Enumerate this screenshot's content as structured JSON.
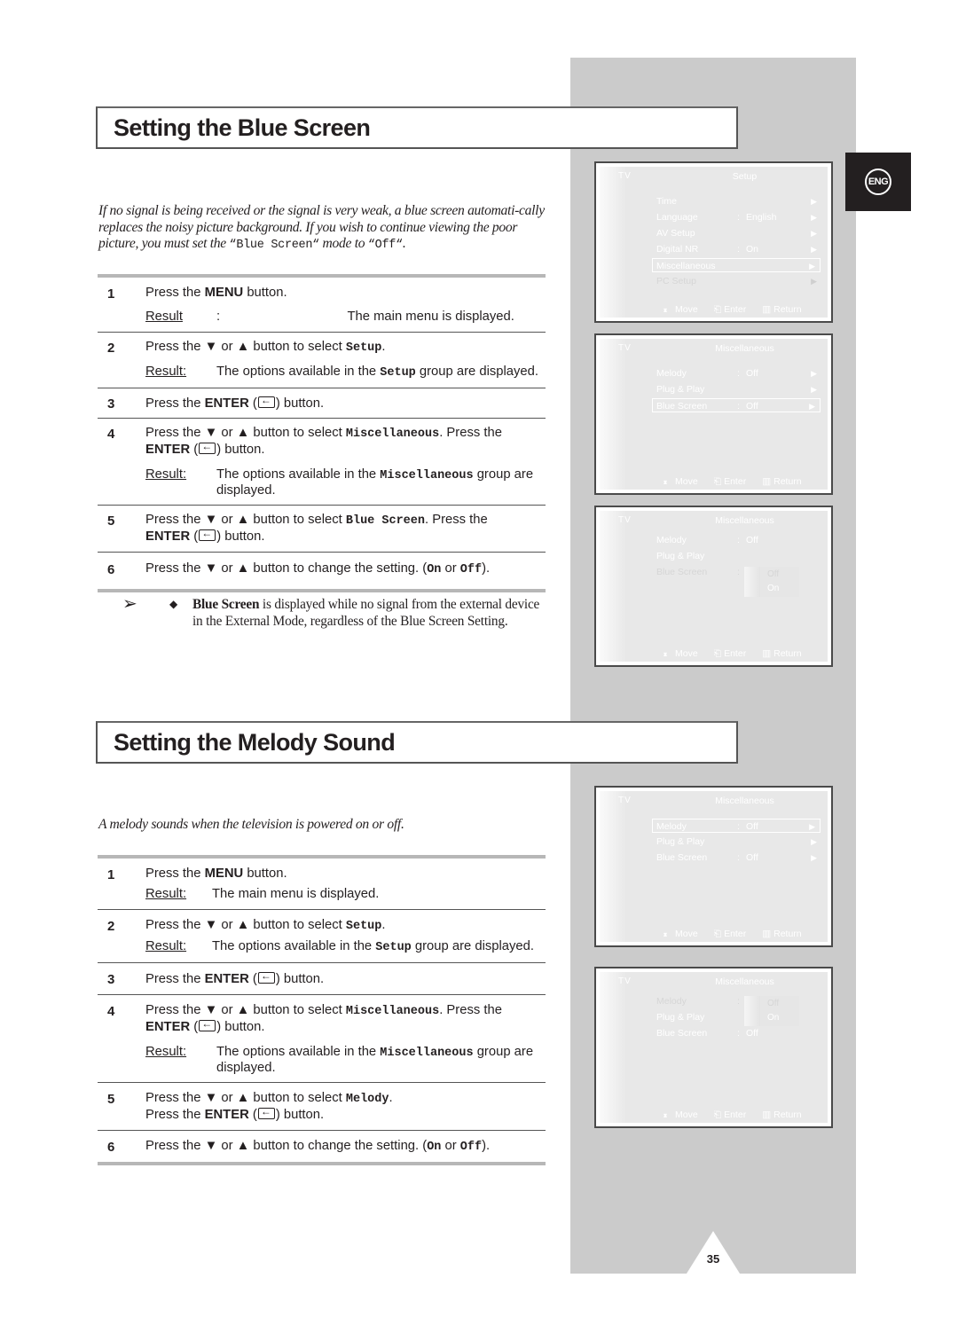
{
  "page": {
    "language_badge": "ENG",
    "page_number": "35"
  },
  "blue_screen": {
    "title": "Setting the Blue Screen",
    "intro": {
      "part1": "If no signal is being received or the signal is very weak, a blue screen automati-cally replaces the noisy picture background. If you wish to continue viewing the poor picture, you must set the ",
      "code1": "“Blue Screen“",
      "part2": " mode to ",
      "code2": "“Off“",
      "part3": "."
    },
    "steps": [
      {
        "num": "1",
        "pre": "Press the ",
        "key": "MENU",
        "post": " button.",
        "result_label": "Result",
        "result": "The main menu is displayed."
      },
      {
        "num": "2",
        "pre": "Press the ▼ or ▲ button to select ",
        "code": "Setup",
        "post": ".",
        "result_label": "Result",
        "result_pre": "The options available in the ",
        "result_code": "Setup",
        "result_post": " group are displayed."
      },
      {
        "num": "3",
        "pre": "Press the ",
        "key": "ENTER",
        "open": " (",
        "close": ") button."
      },
      {
        "num": "4",
        "pre": "Press the ▼ or ▲ button to select ",
        "code": "Miscellaneous",
        "mid": ". Press the",
        "key": "ENTER",
        "open": " (",
        "close": ") button.",
        "result_label": "Result",
        "result_pre": "The options available in the ",
        "result_code": "Miscellaneous",
        "result_post": " group are displayed."
      },
      {
        "num": "5",
        "pre": "Press the ▼ or ▲ button to select ",
        "code": "Blue Screen",
        "mid": ". Press the",
        "key": "ENTER",
        "open": " (",
        "close": ") button."
      },
      {
        "num": "6",
        "pre": "Press the ▼ or ▲ button to change the setting. (",
        "code_on": "On",
        "or": " or ",
        "code_off": "Off",
        "post": ")."
      }
    ],
    "note": {
      "bold": "Blue Screen",
      "text": " is displayed while no signal from the external device in the External Mode, regardless of the Blue Screen Setting."
    }
  },
  "melody": {
    "title": "Setting the Melody Sound",
    "intro": "A melody sounds when the television is powered on or off.",
    "steps": [
      {
        "num": "1",
        "pre": "Press the ",
        "key": "MENU",
        "post": " button.",
        "result_label": "Result",
        "result": "The main menu is displayed."
      },
      {
        "num": "2",
        "pre": "Press the ▼ or ▲ button to select ",
        "code": "Setup",
        "post": ".",
        "result_label": "Result",
        "result_pre": "The options available in the ",
        "result_code": "Setup",
        "result_post": " group are displayed."
      },
      {
        "num": "3",
        "pre": "Press the ",
        "key": "ENTER",
        "open": " (",
        "close": ") button."
      },
      {
        "num": "4",
        "pre": "Press the ▼ or ▲ button to select ",
        "code": "Miscellaneous",
        "mid": ". Press the",
        "key": "ENTER",
        "open": " (",
        "close": ") button.",
        "result_label": "Result",
        "result_pre": "The options available in the ",
        "result_code": "Miscellaneous",
        "result_post": " group are displayed."
      },
      {
        "num": "5",
        "pre": "Press the ▼ or ▲ button to select ",
        "code": "Melody",
        "mid": ".",
        "line2": "Press the ",
        "key": "ENTER",
        "open": " (",
        "close": ") button."
      },
      {
        "num": "6",
        "pre": "Press the ▼ or ▲ button to change the setting. (",
        "code_on": "On",
        "or": " or ",
        "code_off": "Off",
        "post": ")."
      }
    ]
  },
  "osd": {
    "source": "TV",
    "footer": {
      "move": "Move",
      "enter": "Enter",
      "return": "Return"
    },
    "arrow": "▶",
    "colon": ":",
    "screens": [
      {
        "title": "Setup",
        "rows": [
          {
            "label": "Time",
            "value": ""
          },
          {
            "label": "Language",
            "value": "English"
          },
          {
            "label": "AV Setup",
            "value": ""
          },
          {
            "label": "Digital NR",
            "value": "On"
          },
          {
            "label": "Miscellaneous",
            "value": "",
            "selected": true
          },
          {
            "label": "PC Setup",
            "value": "",
            "dim": true
          }
        ]
      },
      {
        "title": "Miscellaneous",
        "rows": [
          {
            "label": "Melody",
            "value": "Off"
          },
          {
            "label": "Plug & Play",
            "value": ""
          },
          {
            "label": "Blue Screen",
            "value": "Off",
            "selected": true
          }
        ]
      },
      {
        "title": "Miscellaneous",
        "rows": [
          {
            "label": "Melody",
            "value": "Off"
          },
          {
            "label": "Plug & Play",
            "value": ""
          },
          {
            "label": "Blue Screen",
            "value": "",
            "dim": true
          }
        ],
        "popup": {
          "options": [
            "Off",
            "On"
          ],
          "highlighted": "On"
        }
      },
      {
        "title": "Miscellaneous",
        "rows": [
          {
            "label": "Melody",
            "value": "Off",
            "selected": true
          },
          {
            "label": "Plug & Play",
            "value": ""
          },
          {
            "label": "Blue Screen",
            "value": "Off"
          }
        ]
      },
      {
        "title": "Miscellaneous",
        "rows": [
          {
            "label": "Melody",
            "value": "",
            "dim": true
          },
          {
            "label": "Plug & Play",
            "value": ""
          },
          {
            "label": "Blue Screen",
            "value": "Off"
          }
        ],
        "popup": {
          "options": [
            "Off",
            "On"
          ],
          "highlighted": "On"
        }
      }
    ]
  }
}
